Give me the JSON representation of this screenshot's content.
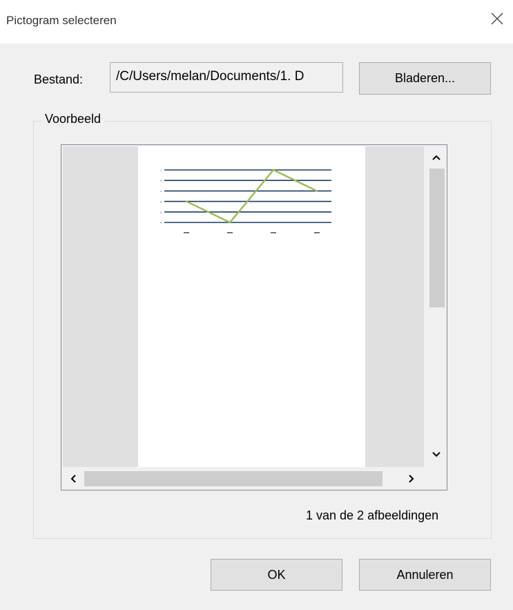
{
  "dialog": {
    "title": "Pictogram selecteren"
  },
  "file": {
    "label": "Bestand:",
    "path": "/C/Users/melan/Documents/1. D",
    "browse_label": "Bladeren..."
  },
  "preview": {
    "group_label": "Voorbeeld",
    "image_count_text": "1 van de 2 afbeeldingen"
  },
  "chart_data": {
    "type": "line",
    "categories": [
      "",
      "",
      "",
      ""
    ],
    "values": [
      -2,
      -4,
      1,
      -1
    ],
    "ylim": [
      -4,
      1
    ],
    "yticks": [
      1,
      0,
      -1,
      -2,
      -3,
      -4
    ],
    "grid": true,
    "line_color": "#9bbb59",
    "grid_color": "#1f3864"
  },
  "buttons": {
    "ok_label": "OK",
    "cancel_label": "Annuleren"
  }
}
